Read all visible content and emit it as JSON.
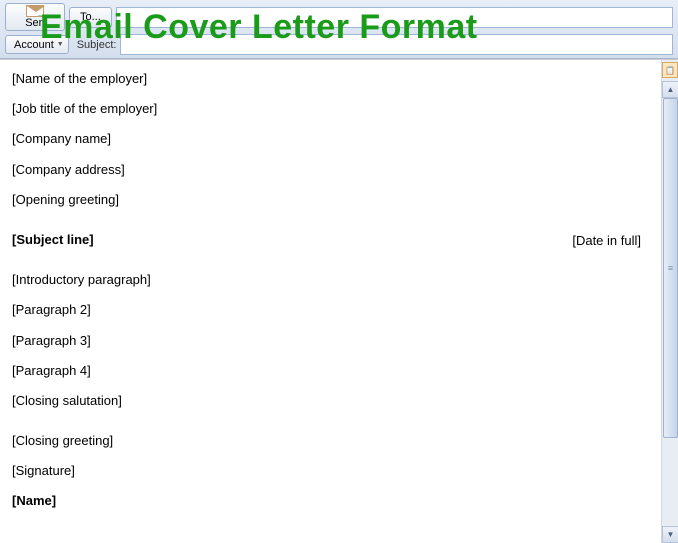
{
  "overlay": {
    "title": "Email Cover Letter Format"
  },
  "toolbar": {
    "send_label": "Sen",
    "to_label": "To...",
    "account_label": "Account",
    "subject_label": "Subject:"
  },
  "body": {
    "line1": "[Name of the employer]",
    "line2": "[Job title of the employer]",
    "line3": "[Company name]",
    "line4": "[Company address]",
    "line5": "[Opening greeting]",
    "date": "[Date in full]",
    "subject": "[Subject line]",
    "intro": "[Introductory paragraph]",
    "p2": "[Paragraph 2]",
    "p3": "[Paragraph 3]",
    "p4": "[Paragraph 4]",
    "closing_sal": "[Closing salutation]",
    "closing_greet": "[Closing greeting]",
    "signature": "[Signature]",
    "name": "[Name]"
  }
}
